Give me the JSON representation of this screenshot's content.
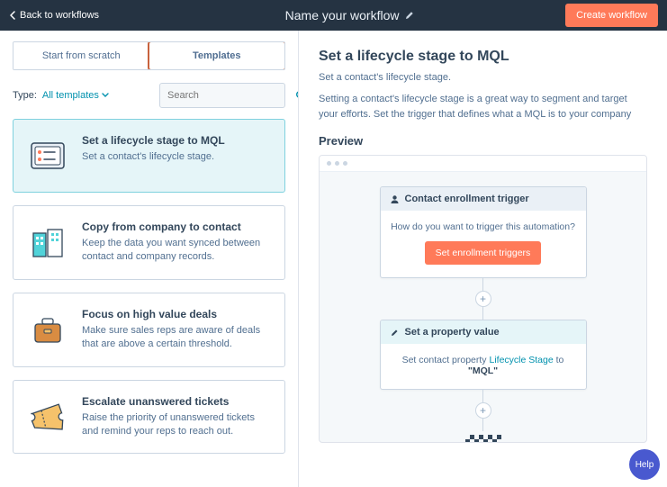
{
  "topbar": {
    "back_label": "Back to workflows",
    "title": "Name your workflow",
    "create_label": "Create workflow"
  },
  "tabs": {
    "scratch": "Start from scratch",
    "templates": "Templates"
  },
  "filter": {
    "type_label": "Type:",
    "type_value": "All templates",
    "search_placeholder": "Search"
  },
  "templates": [
    {
      "title": "Set a lifecycle stage to MQL",
      "desc": "Set a contact's lifecycle stage."
    },
    {
      "title": "Copy from company to contact",
      "desc": "Keep the data you want synced between contact and company records."
    },
    {
      "title": "Focus on high value deals",
      "desc": "Make sure sales reps are aware of deals that are above a certain threshold."
    },
    {
      "title": "Escalate unanswered tickets",
      "desc": "Raise the priority of unanswered tickets and remind your reps to reach out."
    }
  ],
  "detail": {
    "title": "Set a lifecycle stage to MQL",
    "subtitle": "Set a contact's lifecycle stage.",
    "paragraph": "Setting a contact's lifecycle stage is a great way to segment and target your efforts. Set the trigger that defines what a MQL is to your company",
    "preview_heading": "Preview"
  },
  "workflow": {
    "enroll_head": "Contact enrollment trigger",
    "enroll_question": "How do you want to trigger this automation?",
    "enroll_button": "Set enrollment triggers",
    "action_head": "Set a property value",
    "action_line_pre": "Set contact property ",
    "action_link": "Lifecycle Stage",
    "action_line_post": " to",
    "action_value": "\"MQL\""
  },
  "help_label": "Help"
}
